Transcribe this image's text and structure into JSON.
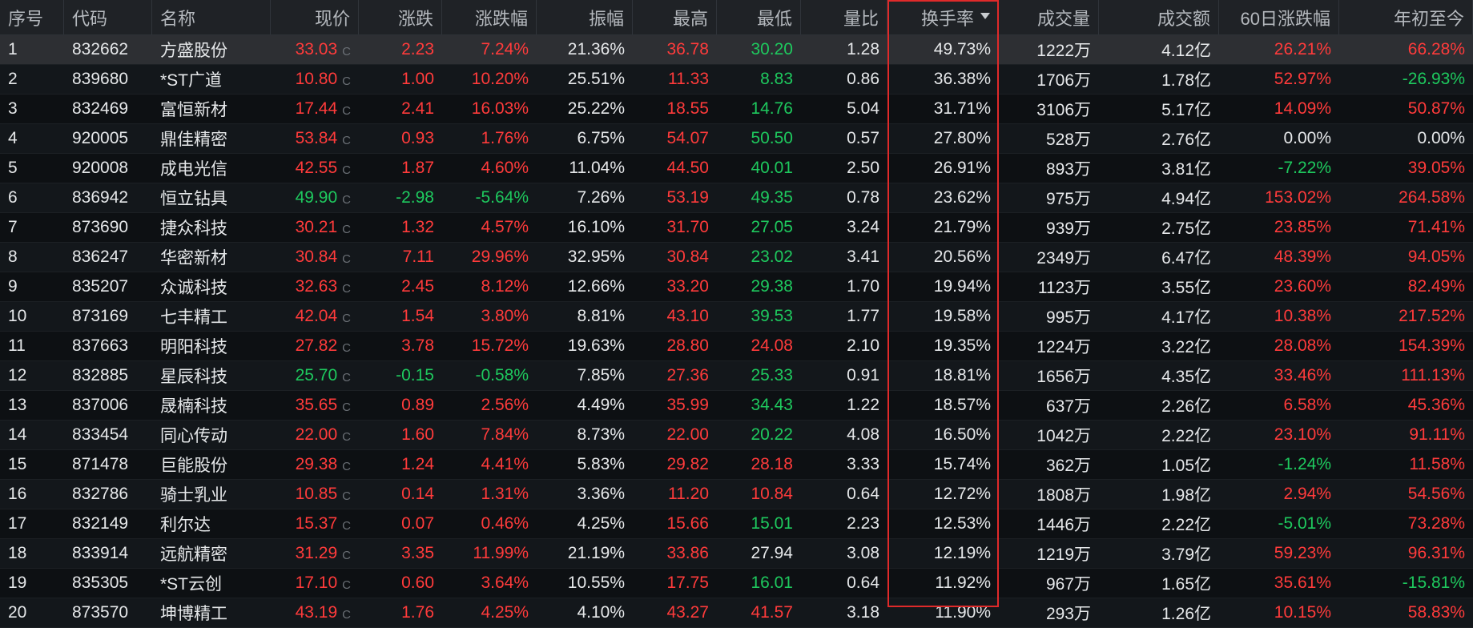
{
  "colors": {
    "up": "#ff3b3b",
    "down": "#1ec95e",
    "highlight": "#e02a2a",
    "background": "#0d1013"
  },
  "columns": [
    {
      "key": "idx",
      "label": "序号",
      "align": "l"
    },
    {
      "key": "code",
      "label": "代码",
      "align": "l"
    },
    {
      "key": "name",
      "label": "名称",
      "align": "l"
    },
    {
      "key": "price",
      "label": "现价",
      "align": "r"
    },
    {
      "key": "chg",
      "label": "涨跌",
      "align": "r"
    },
    {
      "key": "pct",
      "label": "涨跌幅",
      "align": "r"
    },
    {
      "key": "amp",
      "label": "振幅",
      "align": "r"
    },
    {
      "key": "high",
      "label": "最高",
      "align": "r"
    },
    {
      "key": "low",
      "label": "最低",
      "align": "r"
    },
    {
      "key": "vr",
      "label": "量比",
      "align": "r"
    },
    {
      "key": "turnover",
      "label": "换手率",
      "align": "r",
      "sorted": "desc"
    },
    {
      "key": "vol",
      "label": "成交量",
      "align": "r"
    },
    {
      "key": "amount",
      "label": "成交额",
      "align": "r"
    },
    {
      "key": "pct60",
      "label": "60日涨跌幅",
      "align": "r"
    },
    {
      "key": "ytd",
      "label": "年初至今",
      "align": "r"
    }
  ],
  "price_suffix": "C",
  "rows": [
    {
      "idx": "1",
      "code": "832662",
      "name": "方盛股份",
      "price": "33.03",
      "chg": "2.23",
      "pct": "7.24%",
      "amp": "21.36%",
      "high": "36.78",
      "low": "30.20",
      "vr": "1.28",
      "turnover": "49.73%",
      "vol": "1222万",
      "amount": "4.12亿",
      "pct60": "26.21%",
      "ytd": "66.28%",
      "dir": "up",
      "high_dir": "up",
      "low_dir": "down",
      "pct60_dir": "up",
      "ytd_dir": "up"
    },
    {
      "idx": "2",
      "code": "839680",
      "name": "*ST广道",
      "price": "10.80",
      "chg": "1.00",
      "pct": "10.20%",
      "amp": "25.51%",
      "high": "11.33",
      "low": "8.83",
      "vr": "0.86",
      "turnover": "36.38%",
      "vol": "1706万",
      "amount": "1.78亿",
      "pct60": "52.97%",
      "ytd": "-26.93%",
      "dir": "up",
      "high_dir": "up",
      "low_dir": "down",
      "pct60_dir": "up",
      "ytd_dir": "down"
    },
    {
      "idx": "3",
      "code": "832469",
      "name": "富恒新材",
      "price": "17.44",
      "chg": "2.41",
      "pct": "16.03%",
      "amp": "25.22%",
      "high": "18.55",
      "low": "14.76",
      "vr": "5.04",
      "turnover": "31.71%",
      "vol": "3106万",
      "amount": "5.17亿",
      "pct60": "14.09%",
      "ytd": "50.87%",
      "dir": "up",
      "high_dir": "up",
      "low_dir": "down",
      "pct60_dir": "up",
      "ytd_dir": "up"
    },
    {
      "idx": "4",
      "code": "920005",
      "name": "鼎佳精密",
      "price": "53.84",
      "chg": "0.93",
      "pct": "1.76%",
      "amp": "6.75%",
      "high": "54.07",
      "low": "50.50",
      "vr": "0.57",
      "turnover": "27.80%",
      "vol": "528万",
      "amount": "2.76亿",
      "pct60": "0.00%",
      "ytd": "0.00%",
      "dir": "up",
      "high_dir": "up",
      "low_dir": "down",
      "pct60_dir": "flat",
      "ytd_dir": "flat"
    },
    {
      "idx": "5",
      "code": "920008",
      "name": "成电光信",
      "price": "42.55",
      "chg": "1.87",
      "pct": "4.60%",
      "amp": "11.04%",
      "high": "44.50",
      "low": "40.01",
      "vr": "2.50",
      "turnover": "26.91%",
      "vol": "893万",
      "amount": "3.81亿",
      "pct60": "-7.22%",
      "ytd": "39.05%",
      "dir": "up",
      "high_dir": "up",
      "low_dir": "down",
      "pct60_dir": "down",
      "ytd_dir": "up"
    },
    {
      "idx": "6",
      "code": "836942",
      "name": "恒立钻具",
      "price": "49.90",
      "chg": "-2.98",
      "pct": "-5.64%",
      "amp": "7.26%",
      "high": "53.19",
      "low": "49.35",
      "vr": "0.78",
      "turnover": "23.62%",
      "vol": "975万",
      "amount": "4.94亿",
      "pct60": "153.02%",
      "ytd": "264.58%",
      "dir": "down",
      "high_dir": "up",
      "low_dir": "down",
      "pct60_dir": "up",
      "ytd_dir": "up"
    },
    {
      "idx": "7",
      "code": "873690",
      "name": "捷众科技",
      "price": "30.21",
      "chg": "1.32",
      "pct": "4.57%",
      "amp": "16.10%",
      "high": "31.70",
      "low": "27.05",
      "vr": "3.24",
      "turnover": "21.79%",
      "vol": "939万",
      "amount": "2.75亿",
      "pct60": "23.85%",
      "ytd": "71.41%",
      "dir": "up",
      "high_dir": "up",
      "low_dir": "down",
      "pct60_dir": "up",
      "ytd_dir": "up"
    },
    {
      "idx": "8",
      "code": "836247",
      "name": "华密新材",
      "price": "30.84",
      "chg": "7.11",
      "pct": "29.96%",
      "amp": "32.95%",
      "high": "30.84",
      "low": "23.02",
      "vr": "3.41",
      "turnover": "20.56%",
      "vol": "2349万",
      "amount": "6.47亿",
      "pct60": "48.39%",
      "ytd": "94.05%",
      "dir": "up",
      "high_dir": "up",
      "low_dir": "down",
      "pct60_dir": "up",
      "ytd_dir": "up"
    },
    {
      "idx": "9",
      "code": "835207",
      "name": "众诚科技",
      "price": "32.63",
      "chg": "2.45",
      "pct": "8.12%",
      "amp": "12.66%",
      "high": "33.20",
      "low": "29.38",
      "vr": "1.70",
      "turnover": "19.94%",
      "vol": "1123万",
      "amount": "3.55亿",
      "pct60": "23.60%",
      "ytd": "82.49%",
      "dir": "up",
      "high_dir": "up",
      "low_dir": "down",
      "pct60_dir": "up",
      "ytd_dir": "up"
    },
    {
      "idx": "10",
      "code": "873169",
      "name": "七丰精工",
      "price": "42.04",
      "chg": "1.54",
      "pct": "3.80%",
      "amp": "8.81%",
      "high": "43.10",
      "low": "39.53",
      "vr": "1.77",
      "turnover": "19.58%",
      "vol": "995万",
      "amount": "4.17亿",
      "pct60": "10.38%",
      "ytd": "217.52%",
      "dir": "up",
      "high_dir": "up",
      "low_dir": "down",
      "pct60_dir": "up",
      "ytd_dir": "up"
    },
    {
      "idx": "11",
      "code": "837663",
      "name": "明阳科技",
      "price": "27.82",
      "chg": "3.78",
      "pct": "15.72%",
      "amp": "19.63%",
      "high": "28.80",
      "low": "24.08",
      "vr": "2.10",
      "turnover": "19.35%",
      "vol": "1224万",
      "amount": "3.22亿",
      "pct60": "28.08%",
      "ytd": "154.39%",
      "dir": "up",
      "high_dir": "up",
      "low_dir": "up",
      "pct60_dir": "up",
      "ytd_dir": "up"
    },
    {
      "idx": "12",
      "code": "832885",
      "name": "星辰科技",
      "price": "25.70",
      "chg": "-0.15",
      "pct": "-0.58%",
      "amp": "7.85%",
      "high": "27.36",
      "low": "25.33",
      "vr": "0.91",
      "turnover": "18.81%",
      "vol": "1656万",
      "amount": "4.35亿",
      "pct60": "33.46%",
      "ytd": "111.13%",
      "dir": "down",
      "high_dir": "up",
      "low_dir": "down",
      "pct60_dir": "up",
      "ytd_dir": "up"
    },
    {
      "idx": "13",
      "code": "837006",
      "name": "晟楠科技",
      "price": "35.65",
      "chg": "0.89",
      "pct": "2.56%",
      "amp": "4.49%",
      "high": "35.99",
      "low": "34.43",
      "vr": "1.22",
      "turnover": "18.57%",
      "vol": "637万",
      "amount": "2.26亿",
      "pct60": "6.58%",
      "ytd": "45.36%",
      "dir": "up",
      "high_dir": "up",
      "low_dir": "down",
      "pct60_dir": "up",
      "ytd_dir": "up"
    },
    {
      "idx": "14",
      "code": "833454",
      "name": "同心传动",
      "price": "22.00",
      "chg": "1.60",
      "pct": "7.84%",
      "amp": "8.73%",
      "high": "22.00",
      "low": "20.22",
      "vr": "4.08",
      "turnover": "16.50%",
      "vol": "1042万",
      "amount": "2.22亿",
      "pct60": "23.10%",
      "ytd": "91.11%",
      "dir": "up",
      "high_dir": "up",
      "low_dir": "down",
      "pct60_dir": "up",
      "ytd_dir": "up"
    },
    {
      "idx": "15",
      "code": "871478",
      "name": "巨能股份",
      "price": "29.38",
      "chg": "1.24",
      "pct": "4.41%",
      "amp": "5.83%",
      "high": "29.82",
      "low": "28.18",
      "vr": "3.33",
      "turnover": "15.74%",
      "vol": "362万",
      "amount": "1.05亿",
      "pct60": "-1.24%",
      "ytd": "11.58%",
      "dir": "up",
      "high_dir": "up",
      "low_dir": "up",
      "pct60_dir": "down",
      "ytd_dir": "up"
    },
    {
      "idx": "16",
      "code": "832786",
      "name": "骑士乳业",
      "price": "10.85",
      "chg": "0.14",
      "pct": "1.31%",
      "amp": "3.36%",
      "high": "11.20",
      "low": "10.84",
      "vr": "0.64",
      "turnover": "12.72%",
      "vol": "1808万",
      "amount": "1.98亿",
      "pct60": "2.94%",
      "ytd": "54.56%",
      "dir": "up",
      "high_dir": "up",
      "low_dir": "up",
      "pct60_dir": "up",
      "ytd_dir": "up"
    },
    {
      "idx": "17",
      "code": "832149",
      "name": "利尔达",
      "price": "15.37",
      "chg": "0.07",
      "pct": "0.46%",
      "amp": "4.25%",
      "high": "15.66",
      "low": "15.01",
      "vr": "2.23",
      "turnover": "12.53%",
      "vol": "1446万",
      "amount": "2.22亿",
      "pct60": "-5.01%",
      "ytd": "73.28%",
      "dir": "up",
      "high_dir": "up",
      "low_dir": "down",
      "pct60_dir": "down",
      "ytd_dir": "up"
    },
    {
      "idx": "18",
      "code": "833914",
      "name": "远航精密",
      "price": "31.29",
      "chg": "3.35",
      "pct": "11.99%",
      "amp": "21.19%",
      "high": "33.86",
      "low": "27.94",
      "vr": "3.08",
      "turnover": "12.19%",
      "vol": "1219万",
      "amount": "3.79亿",
      "pct60": "59.23%",
      "ytd": "96.31%",
      "dir": "up",
      "high_dir": "up",
      "low_dir": "flat",
      "pct60_dir": "up",
      "ytd_dir": "up"
    },
    {
      "idx": "19",
      "code": "835305",
      "name": "*ST云创",
      "price": "17.10",
      "chg": "0.60",
      "pct": "3.64%",
      "amp": "10.55%",
      "high": "17.75",
      "low": "16.01",
      "vr": "0.64",
      "turnover": "11.92%",
      "vol": "967万",
      "amount": "1.65亿",
      "pct60": "35.61%",
      "ytd": "-15.81%",
      "dir": "up",
      "high_dir": "up",
      "low_dir": "down",
      "pct60_dir": "up",
      "ytd_dir": "down"
    },
    {
      "idx": "20",
      "code": "873570",
      "name": "坤博精工",
      "price": "43.19",
      "chg": "1.76",
      "pct": "4.25%",
      "amp": "4.10%",
      "high": "43.27",
      "low": "41.57",
      "vr": "3.18",
      "turnover": "11.90%",
      "vol": "293万",
      "amount": "1.26亿",
      "pct60": "10.15%",
      "ytd": "58.83%",
      "dir": "up",
      "high_dir": "up",
      "low_dir": "up",
      "pct60_dir": "up",
      "ytd_dir": "up"
    }
  ]
}
